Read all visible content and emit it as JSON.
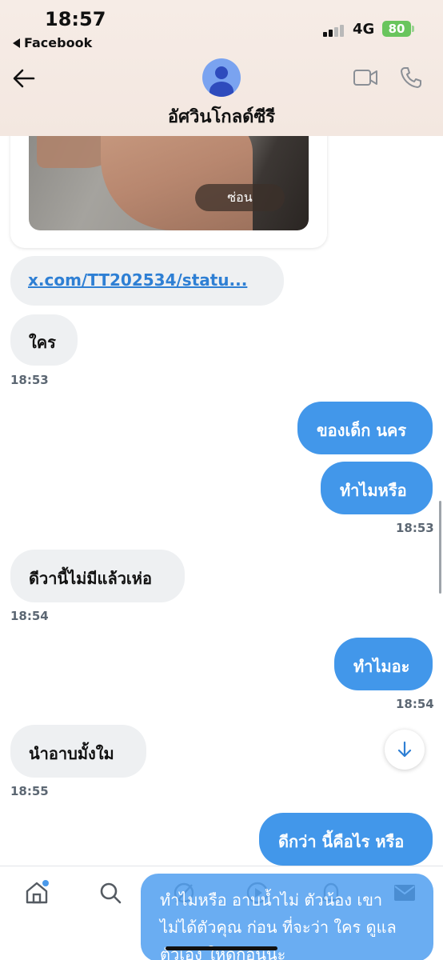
{
  "status_bar": {
    "time": "18:57",
    "back_app": "Facebook",
    "network": "4G",
    "battery": "80"
  },
  "chat_header": {
    "contact_name": "อัศวินโกลด์ซีรี",
    "icons": [
      "back-arrow-icon",
      "avatar",
      "video-call-icon",
      "phone-call-icon"
    ]
  },
  "media": {
    "hide_label": "ซ่อน"
  },
  "messages": [
    {
      "side": "in",
      "text": "x.com/TT202534/statu...",
      "type": "link"
    },
    {
      "side": "in",
      "text": "ใคร"
    },
    {
      "side": "in",
      "timestamp": "18:53"
    },
    {
      "side": "out",
      "text": "ของเด็ก นคร"
    },
    {
      "side": "out",
      "text": "ทำไมหรือ"
    },
    {
      "side": "out",
      "timestamp": "18:53"
    },
    {
      "side": "in",
      "text": "ดีวานี้ไม่มีแล้วเห่อ"
    },
    {
      "side": "in",
      "timestamp": "18:54"
    },
    {
      "side": "out",
      "text": "ทำไมอะ"
    },
    {
      "side": "out",
      "timestamp": "18:54"
    },
    {
      "side": "in",
      "text": "นำอาบมั้งใม"
    },
    {
      "side": "in",
      "timestamp": "18:55"
    },
    {
      "side": "out",
      "text": "ดีกว่า นี้คือไร หรือ"
    }
  ],
  "toast": {
    "lines": [
      "ทำไมหรือ อาบน้ำไม่ ตัวน้อง เขา",
      "ไม่ได้ตัวคุณ ก่อน ที่จะว่า ใคร ดูแล",
      "ตัวเอง ให้ดีก่อนนะ"
    ]
  },
  "bottom_nav": [
    "home-icon",
    "search-icon",
    "grok-icon",
    "play-icon",
    "notifications-icon",
    "messages-icon"
  ],
  "colors": {
    "outgoing_bubble": "#4297ea",
    "incoming_bubble": "#eef0f2",
    "link": "#2e7fd4",
    "header_bg": "#f4e8e1"
  }
}
